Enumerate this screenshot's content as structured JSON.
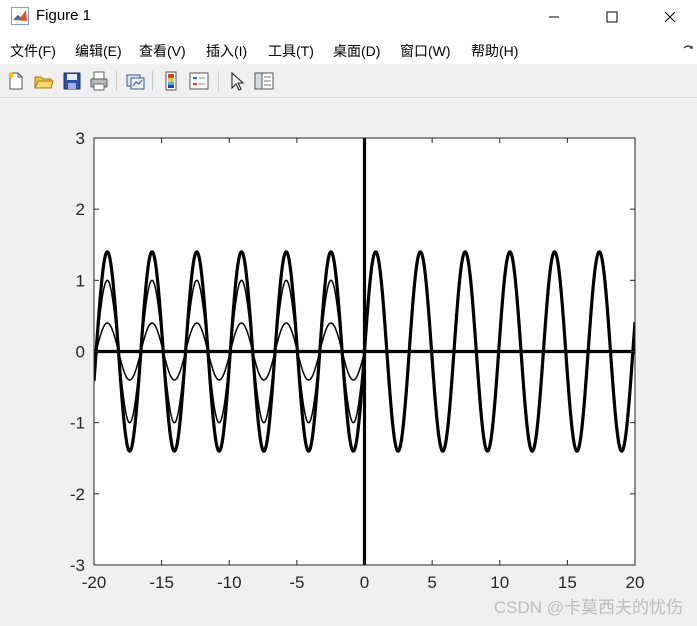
{
  "window": {
    "title": "Figure 1"
  },
  "menu": {
    "items": [
      "文件(F)",
      "编辑(E)",
      "查看(V)",
      "插入(I)",
      "工具(T)",
      "桌面(D)",
      "窗口(W)",
      "帮助(H)"
    ]
  },
  "toolbar": {
    "icons": [
      "new-file-icon",
      "open-folder-icon",
      "save-icon",
      "print-icon",
      "link-plot-icon",
      "colorbar-icon",
      "legend-icon",
      "pointer-icon",
      "property-editor-icon"
    ]
  },
  "watermark": "CSDN @卡莫西夫的忧伤",
  "chart_data": {
    "type": "line",
    "title": "",
    "xlabel": "",
    "ylabel": "",
    "xlim": [
      -20,
      20
    ],
    "ylim": [
      -3,
      3
    ],
    "xticks": [
      -20,
      -15,
      -10,
      -5,
      0,
      5,
      10,
      15,
      20
    ],
    "yticks": [
      -3,
      -2,
      -1,
      0,
      1,
      2,
      3
    ],
    "grid": false,
    "series": [
      {
        "function": "sin(1.9x)",
        "x_range": [
          -20,
          0
        ],
        "amplitude": 1,
        "angular_frequency": 1.9,
        "line": "thin"
      },
      {
        "function": "0.4*sin(1.9x)",
        "x_range": [
          -20,
          0
        ],
        "amplitude": 0.4,
        "angular_frequency": 1.9,
        "line": "thin"
      },
      {
        "function": "1.4*sin(1.9x)",
        "x_range": [
          -20,
          20
        ],
        "amplitude": 1.4,
        "angular_frequency": 1.9,
        "line": "thick"
      }
    ],
    "reference_lines": [
      {
        "axis": "y",
        "value": 0
      },
      {
        "axis": "x",
        "value": 0
      }
    ]
  }
}
